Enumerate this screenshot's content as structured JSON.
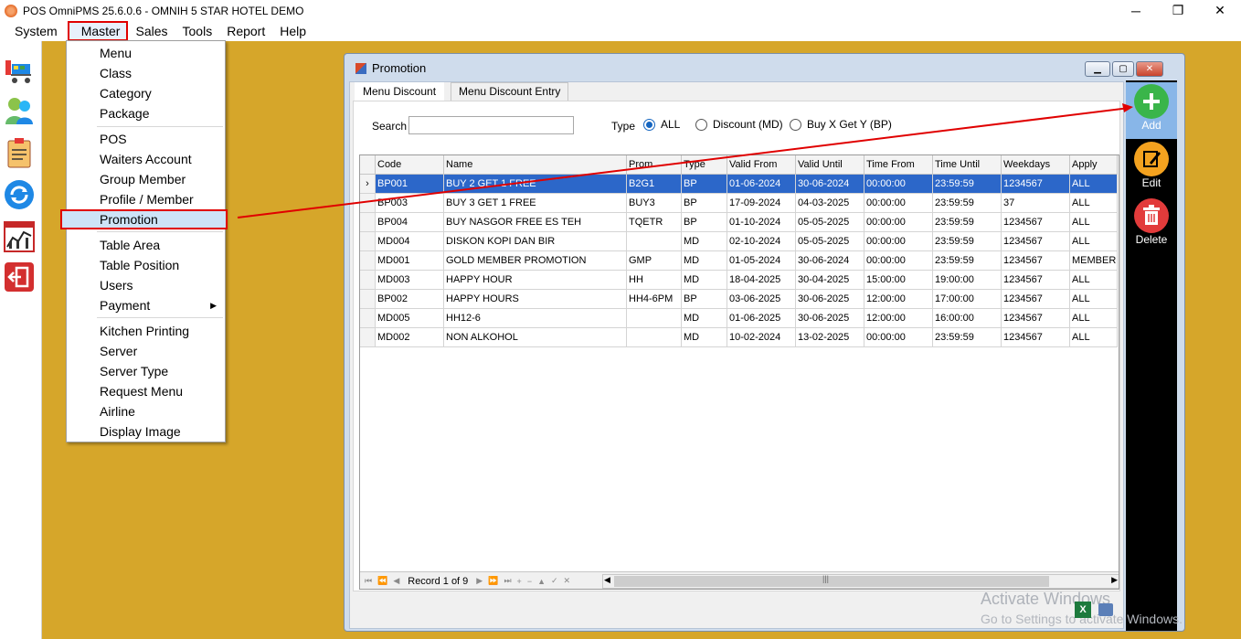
{
  "titlebar": {
    "title": "POS OmniPMS 25.6.0.6 - OMNIH 5 STAR HOTEL DEMO",
    "minimize": "─",
    "restore": "❐",
    "close": "✕"
  },
  "menubar": [
    "System",
    "Master",
    "Sales",
    "Tools",
    "Report",
    "Help"
  ],
  "dropdown": {
    "items": [
      "Menu",
      "Class",
      "Category",
      "Package",
      "POS",
      "Waiters Account",
      "Group Member",
      "Profile / Member",
      "Promotion",
      "Table Area",
      "Table Position",
      "Users",
      "Payment",
      "Kitchen Printing",
      "Server",
      "Server Type",
      "Request Menu",
      "Airline",
      "Display Image"
    ],
    "selected": "Promotion",
    "submenu_arrow": "▶"
  },
  "window": {
    "title": "Promotion",
    "tabs": [
      "Menu Discount",
      "Menu Discount Entry"
    ],
    "search_label": "Search",
    "search_value": "",
    "type_label": "Type",
    "radio": [
      "ALL",
      "Discount (MD)",
      "Buy X Get Y (BP)"
    ],
    "radio_selected": "ALL"
  },
  "grid": {
    "columns": [
      "Code",
      "Name",
      "Prom",
      "Type",
      "Valid From",
      "Valid Until",
      "Time From",
      "Time Until",
      "Weekdays",
      "Apply"
    ],
    "rows": [
      [
        "BP001",
        "BUY 2 GET 1 FREE",
        "B2G1",
        "BP",
        "01-06-2024",
        "30-06-2024",
        "00:00:00",
        "23:59:59",
        "1234567",
        "ALL"
      ],
      [
        "BP003",
        "BUY 3 GET 1 FREE",
        "BUY3",
        "BP",
        "17-09-2024",
        "04-03-2025",
        "00:00:00",
        "23:59:59",
        "37",
        "ALL"
      ],
      [
        "BP004",
        "BUY NASGOR FREE ES TEH",
        "TQETR",
        "BP",
        "01-10-2024",
        "05-05-2025",
        "00:00:00",
        "23:59:59",
        "1234567",
        "ALL"
      ],
      [
        "MD004",
        "DISKON KOPI DAN BIR",
        "",
        "MD",
        "02-10-2024",
        "05-05-2025",
        "00:00:00",
        "23:59:59",
        "1234567",
        "ALL"
      ],
      [
        "MD001",
        "GOLD MEMBER PROMOTION",
        "GMP",
        "MD",
        "01-05-2024",
        "30-06-2024",
        "00:00:00",
        "23:59:59",
        "1234567",
        "MEMBER"
      ],
      [
        "MD003",
        "HAPPY HOUR",
        "HH",
        "MD",
        "18-04-2025",
        "30-04-2025",
        "15:00:00",
        "19:00:00",
        "1234567",
        "ALL"
      ],
      [
        "BP002",
        "HAPPY HOURS",
        "HH4-6PM",
        "BP",
        "03-06-2025",
        "30-06-2025",
        "12:00:00",
        "17:00:00",
        "1234567",
        "ALL"
      ],
      [
        "MD005",
        "HH12-6",
        "",
        "MD",
        "01-06-2025",
        "30-06-2025",
        "12:00:00",
        "16:00:00",
        "1234567",
        "ALL"
      ],
      [
        "MD002",
        "NON ALKOHOL",
        "",
        "MD",
        "10-02-2024",
        "13-02-2025",
        "00:00:00",
        "23:59:59",
        "1234567",
        "ALL"
      ]
    ],
    "selected_row": 0,
    "row_indicator": "›",
    "pager": {
      "record_text": "Record 1 of 9",
      "nav_first": "⏮",
      "nav_prev_page": "⏪",
      "nav_prev": "◀",
      "nav_next": "▶",
      "nav_next_page": "⏩",
      "nav_last": "⏭",
      "nav_add": "+",
      "nav_remove": "−",
      "nav_up": "▲",
      "nav_confirm": "✓",
      "nav_cancel": "✕",
      "scroll_left": "◀",
      "scroll_right": "▶",
      "scroll_grip": "|||"
    }
  },
  "actions": [
    "Add",
    "Edit",
    "Delete"
  ],
  "watermark": {
    "line1": "Activate Windows",
    "line2": "Go to Settings to activate Windows."
  },
  "colors": {
    "desktop": "#d6a62a",
    "selected_row": "#2c67c9",
    "highlight_red": "#e00000",
    "add_green": "#3ab54a",
    "edit_orange": "#f4a21f",
    "delete_red": "#e23b3b"
  }
}
